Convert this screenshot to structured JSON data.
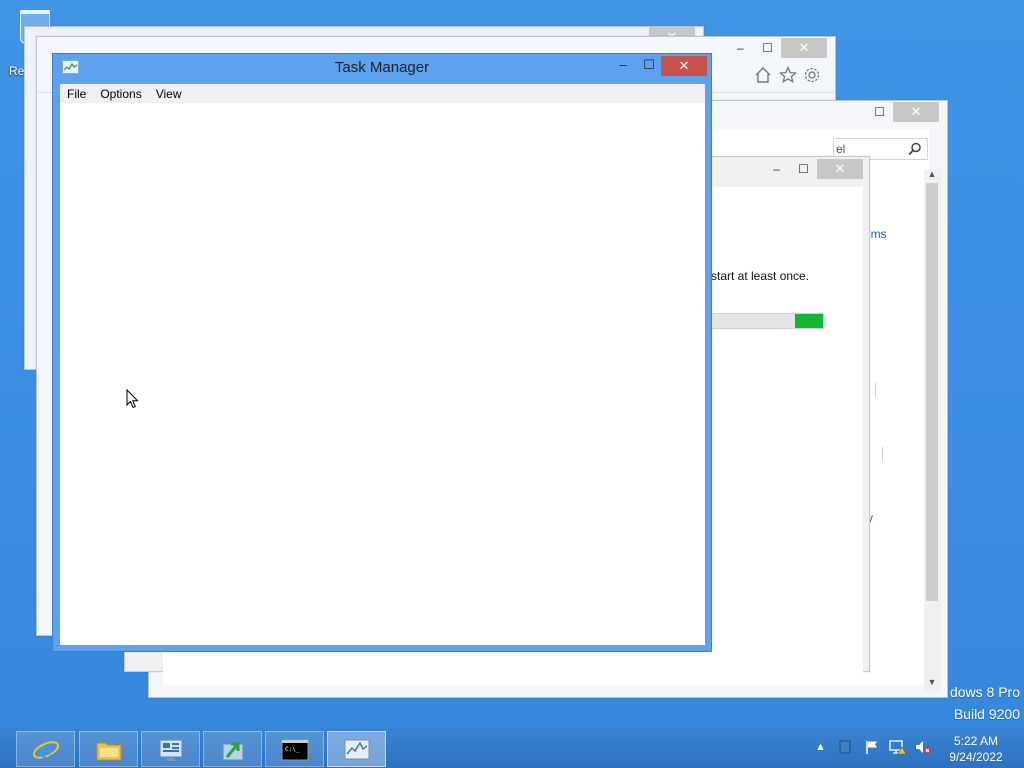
{
  "desktop": {
    "recycle_bin_label": "Rec",
    "watermark_line1": "dows 8 Pro",
    "watermark_line2": "Build 9200"
  },
  "task_manager": {
    "title": "Task Manager",
    "menu": [
      "File",
      "Options",
      "View"
    ],
    "min_glyph": "–",
    "max_glyph": "☐",
    "close_glyph": "✕"
  },
  "background_windows": {
    "search_text": "el",
    "link_items": "ems",
    "update_message": "start at least once.",
    "link_y": "y",
    "update_progress_percent": 95,
    "min_glyph": "–",
    "max_glyph": "☐",
    "close_glyph": "✕"
  },
  "taskbar": {
    "items": [
      {
        "name": "internet-explorer",
        "active": false
      },
      {
        "name": "file-explorer",
        "active": false
      },
      {
        "name": "server-manager",
        "active": false
      },
      {
        "name": "deployment-tool",
        "active": false
      },
      {
        "name": "command-prompt",
        "active": false
      },
      {
        "name": "task-manager",
        "active": true
      }
    ],
    "clock": {
      "time": "5:22 AM",
      "date": "9/24/2022"
    }
  },
  "colors": {
    "desktop": "#3a8de2",
    "task_manager_frame": "#5ea1ee",
    "close_red": "#c7514b",
    "progress_green": "#10b634"
  }
}
